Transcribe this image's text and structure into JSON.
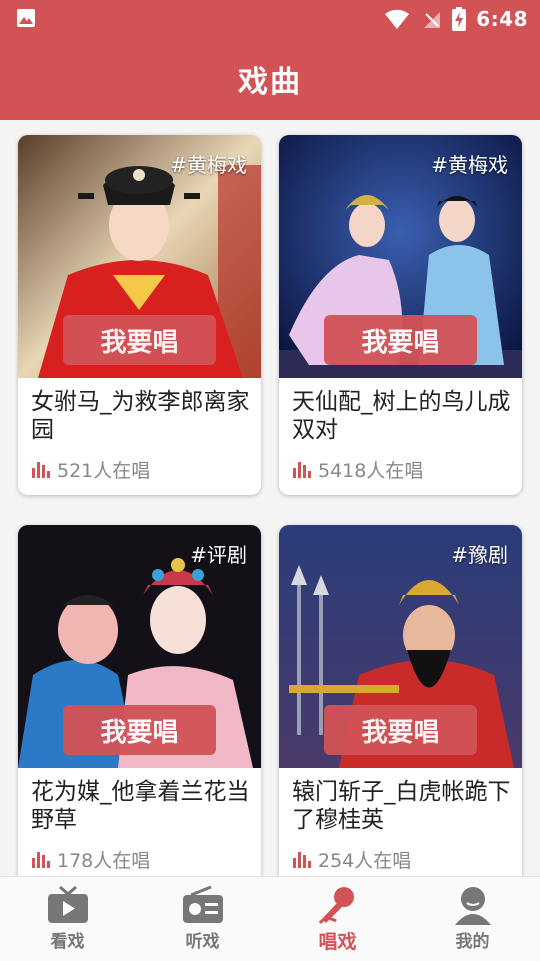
{
  "status": {
    "time": "6:48"
  },
  "header": {
    "title": "戏曲"
  },
  "cards": [
    {
      "tag": "#黄梅戏",
      "button": "我要唱",
      "title": "女驸马_为救李郎离家园",
      "count": "521人在唱"
    },
    {
      "tag": "#黄梅戏",
      "button": "我要唱",
      "title": "天仙配_树上的鸟儿成双对",
      "count": "5418人在唱"
    },
    {
      "tag": "#评剧",
      "button": "我要唱",
      "title": "花为媒_他拿着兰花当野草",
      "count": "178人在唱"
    },
    {
      "tag": "#豫剧",
      "button": "我要唱",
      "title": "辕门斩子_白虎帐跪下了穆桂英",
      "count": "254人在唱"
    }
  ],
  "tabs": [
    {
      "label": "看戏",
      "icon": "tv-play-icon"
    },
    {
      "label": "听戏",
      "icon": "radio-icon"
    },
    {
      "label": "唱戏",
      "icon": "microphone-icon"
    },
    {
      "label": "我的",
      "icon": "user-icon"
    }
  ],
  "colors": {
    "brand": "#d25356",
    "active_tab": "#d25356",
    "inactive_tab": "#777777"
  }
}
